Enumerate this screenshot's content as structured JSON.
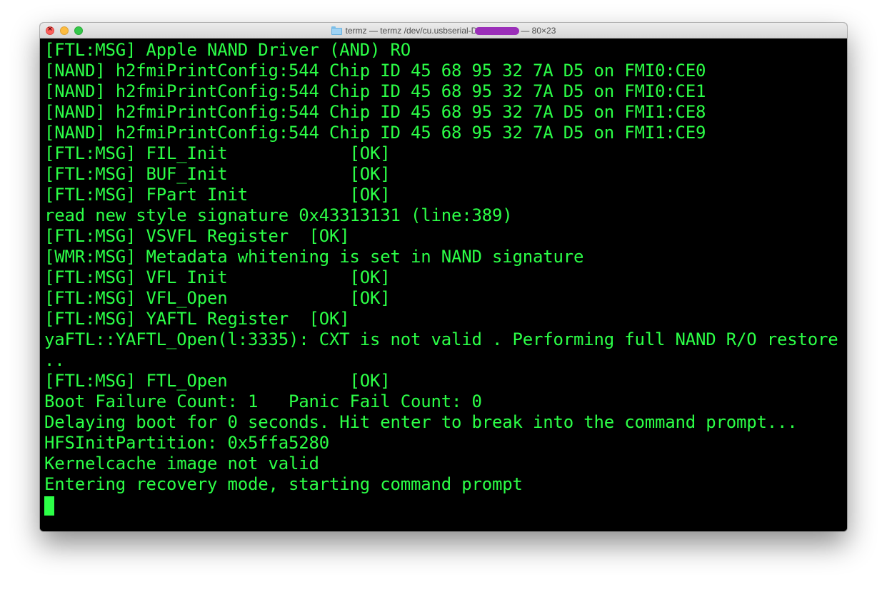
{
  "window": {
    "title_prefix": "termz — termz /dev/cu.usbserial-D",
    "title_suffix": "— 80×23",
    "folder_icon": "folder-icon",
    "redaction_color": "#9b2fb9"
  },
  "terminal": {
    "text_color": "#2cff47",
    "background": "#000000",
    "lines": [
      "[FTL:MSG] Apple NAND Driver (AND) RO",
      "[NAND] h2fmiPrintConfig:544 Chip ID 45 68 95 32 7A D5 on FMI0:CE0",
      "[NAND] h2fmiPrintConfig:544 Chip ID 45 68 95 32 7A D5 on FMI0:CE1",
      "[NAND] h2fmiPrintConfig:544 Chip ID 45 68 95 32 7A D5 on FMI1:CE8",
      "[NAND] h2fmiPrintConfig:544 Chip ID 45 68 95 32 7A D5 on FMI1:CE9",
      "[FTL:MSG] FIL_Init            [OK]",
      "[FTL:MSG] BUF_Init            [OK]",
      "[FTL:MSG] FPart Init          [OK]",
      "read new style signature 0x43313131 (line:389)",
      "[FTL:MSG] VSVFL Register  [OK]",
      "[WMR:MSG] Metadata whitening is set in NAND signature",
      "[FTL:MSG] VFL Init            [OK]",
      "[FTL:MSG] VFL_Open            [OK]",
      "[FTL:MSG] YAFTL Register  [OK]",
      "yaFTL::YAFTL_Open(l:3335): CXT is not valid . Performing full NAND R/O restore .",
      "..",
      "[FTL:MSG] FTL_Open            [OK]",
      "Boot Failure Count: 1   Panic Fail Count: 0",
      "Delaying boot for 0 seconds. Hit enter to break into the command prompt...",
      "HFSInitPartition: 0x5ffa5280",
      "Kernelcache image not valid",
      "Entering recovery mode, starting command prompt"
    ]
  }
}
